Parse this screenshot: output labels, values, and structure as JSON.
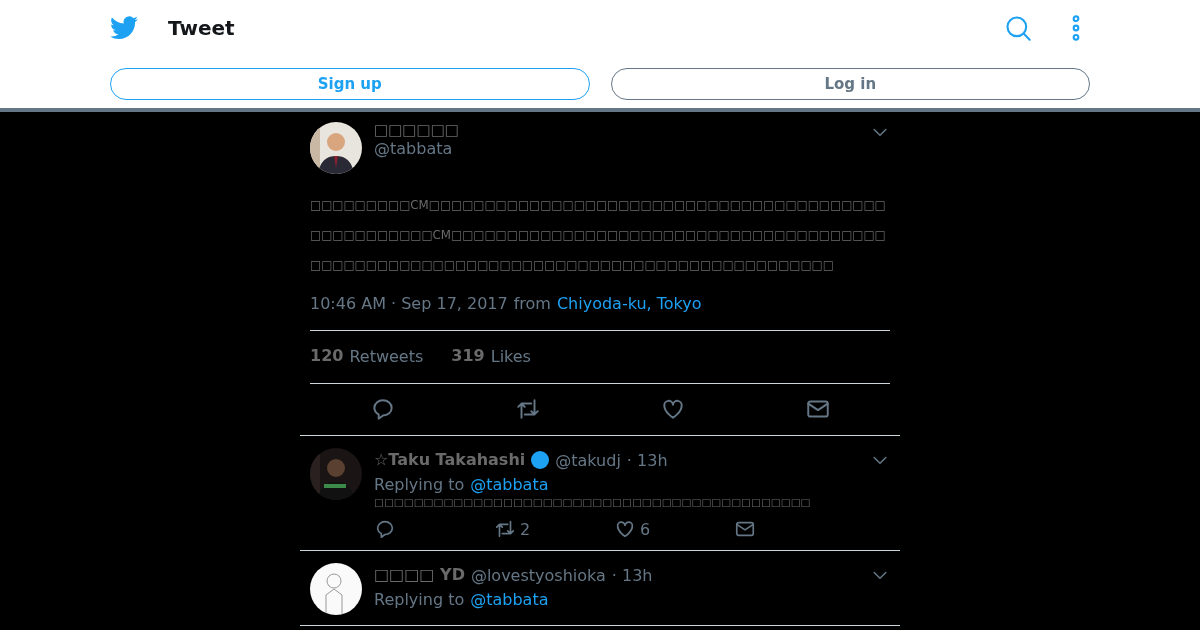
{
  "header": {
    "title": "Tweet",
    "buttons": [
      {
        "label": "Sign up",
        "kind": "primary"
      },
      {
        "label": "Log in",
        "kind": "secondary"
      }
    ]
  },
  "tweet": {
    "name": "□□□□□□",
    "handle": "@tabbata",
    "text": "□□□□□□□□□CM□□□□□□□□□□□□□□□□□□□□□□□□□□□□□□□□□□□□□□□□□□□□□□□□□□□□CM□□□□□□□□□□□□□□□□□□□□□□□□□□□□□□□□□□□□□□□□□□□□□□□□□□□□□□□□□□□□□□□□□□□□□□□□□□□□□□□□□□□□□□",
    "time": "10:46 AM · Sep 17, 2017",
    "from": "from",
    "place": "Chiyoda-ku, Tokyo",
    "stats": [
      {
        "count": "120",
        "label": "Retweets"
      },
      {
        "count": "319",
        "label": "Likes"
      }
    ]
  },
  "replies": [
    {
      "name": "☆Taku Takahashi",
      "verified": true,
      "handle": "@takudj",
      "age": "· 13h",
      "replying": "Replying to",
      "to": "@tabbata",
      "text": "□□□□□□□□□□□□□□□□□□□□□□□□□□□□□□□□□□□□□□□□□□□□",
      "retweets": "2",
      "likes": "6"
    },
    {
      "name": "□□□□ YD",
      "verified": false,
      "handle": "@lovestyoshioka",
      "age": "· 13h",
      "replying": "Replying to",
      "to": "@tabbata"
    }
  ]
}
